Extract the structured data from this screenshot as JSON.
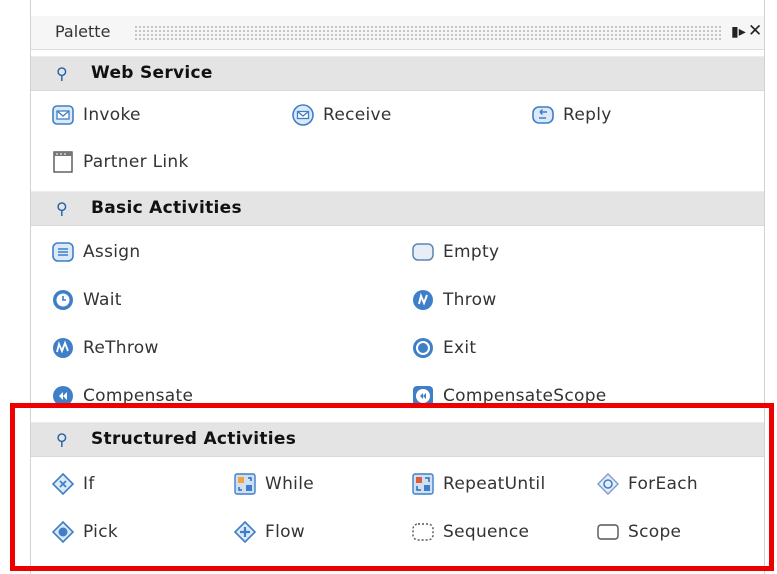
{
  "palette": {
    "title": "Palette",
    "dock_glyph": "▮▸",
    "close_glyph": "✕",
    "sections": [
      {
        "label": "Web Service",
        "items": [
          {
            "label": "Invoke",
            "icon": "invoke-icon"
          },
          {
            "label": "Receive",
            "icon": "receive-icon"
          },
          {
            "label": "Reply",
            "icon": "reply-icon"
          },
          {
            "label": "Partner Link",
            "icon": "partner-link-icon"
          }
        ]
      },
      {
        "label": "Basic Activities",
        "items": [
          {
            "label": "Assign",
            "icon": "assign-icon"
          },
          {
            "label": "Empty",
            "icon": "empty-icon"
          },
          {
            "label": "Wait",
            "icon": "wait-icon"
          },
          {
            "label": "Throw",
            "icon": "throw-icon"
          },
          {
            "label": "ReThrow",
            "icon": "rethrow-icon"
          },
          {
            "label": "Exit",
            "icon": "exit-icon"
          },
          {
            "label": "Compensate",
            "icon": "compensate-icon"
          },
          {
            "label": "CompensateScope",
            "icon": "compensate-scope-icon"
          }
        ]
      },
      {
        "label": "Structured Activities",
        "items": [
          {
            "label": "If",
            "icon": "if-icon"
          },
          {
            "label": "While",
            "icon": "while-icon"
          },
          {
            "label": "RepeatUntil",
            "icon": "repeat-until-icon"
          },
          {
            "label": "ForEach",
            "icon": "foreach-icon"
          },
          {
            "label": "Pick",
            "icon": "pick-icon"
          },
          {
            "label": "Flow",
            "icon": "flow-icon"
          },
          {
            "label": "Sequence",
            "icon": "sequence-icon"
          },
          {
            "label": "Scope",
            "icon": "scope-icon"
          }
        ]
      }
    ]
  },
  "colors": {
    "highlight": "#ee0000",
    "section_header_bg": "#e4e4e4",
    "icon_blue": "#3f7fc8"
  }
}
